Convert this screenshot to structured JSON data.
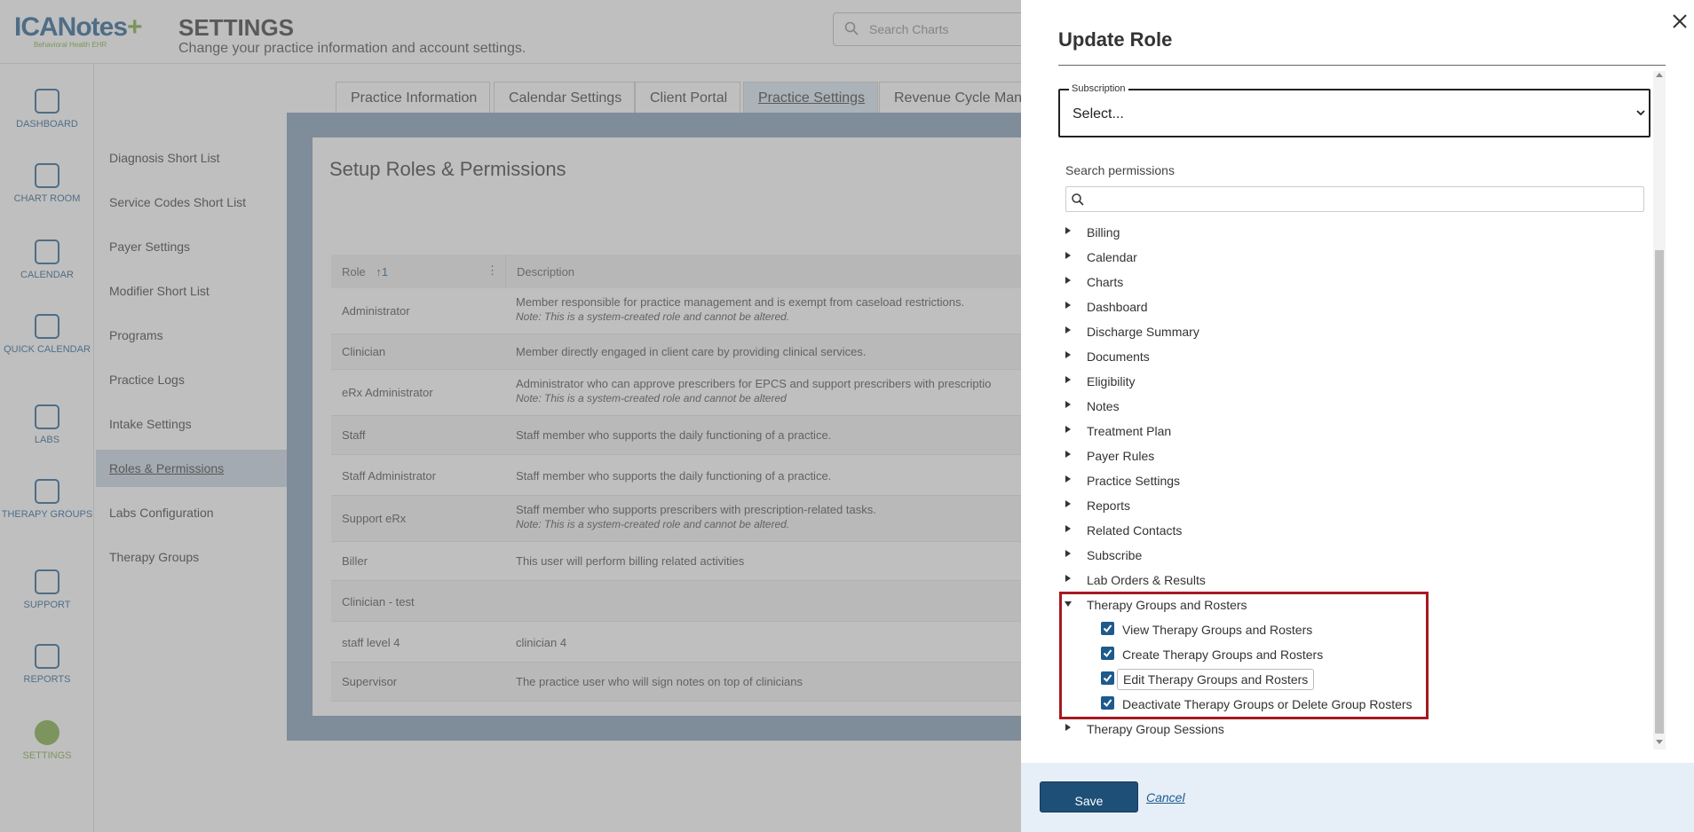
{
  "app": {
    "logo_text": "ICANotes",
    "logo_plus": "+",
    "logo_sub": "Behavioral Health EHR",
    "title": "SETTINGS",
    "subtitle": "Change your practice information and account settings.",
    "search_placeholder": "Search Charts"
  },
  "leftnav": [
    {
      "label": "DASHBOARD",
      "icon": "dashboard-icon"
    },
    {
      "label": "CHART ROOM",
      "icon": "chart-room-icon"
    },
    {
      "label": "CALENDAR",
      "icon": "calendar-icon"
    },
    {
      "label": "QUICK CALENDAR",
      "icon": "quick-calendar-icon"
    },
    {
      "label": "LABS",
      "icon": "flask-icon"
    },
    {
      "label": "THERAPY GROUPS",
      "icon": "group-icon"
    },
    {
      "label": "SUPPORT",
      "icon": "chat-icon"
    },
    {
      "label": "REPORTS",
      "icon": "report-icon"
    },
    {
      "label": "SETTINGS",
      "icon": "gear-icon"
    }
  ],
  "submenu": [
    "Diagnosis Short List",
    "Service Codes Short List",
    "Payer Settings",
    "Modifier Short List",
    "Programs",
    "Practice Logs",
    "Intake Settings",
    "Roles & Permissions",
    "Labs Configuration",
    "Therapy Groups"
  ],
  "tabs": [
    "Practice Information",
    "Calendar Settings",
    "Client Portal",
    "Practice Settings",
    "Revenue Cycle Mana"
  ],
  "panel": {
    "title": "Setup Roles & Permissions",
    "col_role": "Role",
    "col_sort": "↑1",
    "col_desc": "Description",
    "rows": [
      {
        "role": "Administrator",
        "desc": "Member responsible for practice management and is exempt from caseload restrictions.",
        "note": "Note: This is a system-created role and cannot be altered."
      },
      {
        "role": "Clinician",
        "desc": "Member directly engaged in client care by providing clinical services.",
        "note": ""
      },
      {
        "role": "eRx Administrator",
        "desc": "Administrator who can approve prescribers for EPCS and support prescribers with prescriptio",
        "note": "Note: This is a system-created role and cannot be altered"
      },
      {
        "role": "Staff",
        "desc": "Staff member who supports the daily functioning of a practice.",
        "note": ""
      },
      {
        "role": "Staff Administrator",
        "desc": "Staff member who supports the daily functioning of a practice.",
        "note": ""
      },
      {
        "role": "Support eRx",
        "desc": "Staff member who supports prescribers with prescription-related tasks.",
        "note": "Note: This is a system-created role and cannot be altered."
      },
      {
        "role": "Biller",
        "desc": "This user will perform billing related activities",
        "note": ""
      },
      {
        "role": "Clinician - test",
        "desc": "",
        "note": ""
      },
      {
        "role": "staff level 4",
        "desc": "clinician 4",
        "note": ""
      },
      {
        "role": "Supervisor",
        "desc": "The practice user who will sign notes on top of clinicians",
        "note": ""
      }
    ]
  },
  "drawer": {
    "title": "Update Role",
    "subscription_label": "Subscription",
    "subscription_value": "Select...",
    "search_label": "Search permissions",
    "search_value": "",
    "tree": [
      "Billing",
      "Calendar",
      "Charts",
      "Dashboard",
      "Discharge Summary",
      "Documents",
      "Eligibility",
      "Notes",
      "Treatment Plan",
      "Payer Rules",
      "Practice Settings",
      "Reports",
      "Related Contacts",
      "Subscribe",
      "Lab Orders & Results"
    ],
    "expanded_group": "Therapy Groups and Rosters",
    "expanded_items": [
      {
        "label": "View Therapy Groups and Rosters",
        "checked": true
      },
      {
        "label": "Create Therapy Groups and Rosters",
        "checked": true
      },
      {
        "label": "Edit Therapy Groups and Rosters",
        "checked": true
      },
      {
        "label": "Deactivate Therapy Groups or Delete Group Rosters",
        "checked": true
      }
    ],
    "after_group": "Therapy Group Sessions",
    "save_label": "Save",
    "cancel_label": "Cancel"
  },
  "colors": {
    "primary": "#1e4f77",
    "highlight": "#a41a20",
    "footer_bg": "#e6eef8",
    "brand_green": "#7aa93c"
  }
}
